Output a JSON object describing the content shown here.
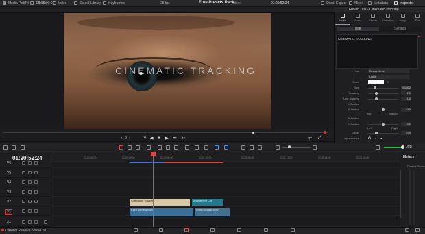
{
  "topbar": {
    "items": [
      "Media Pool",
      "Effects",
      "Index",
      "Sound Library",
      "Keyframes"
    ],
    "project_title": "Free Presets Pack",
    "project_state": "Edited",
    "right_items": [
      "Quick Export",
      "Mixer",
      "Metadata",
      "Inspector"
    ]
  },
  "viewer": {
    "zoom": "24%",
    "timecode_in": "00:00:00:01",
    "fps": "25 fps",
    "timecode": "01:20:52:24",
    "title_text": "CINEMATIC TRACKING",
    "frame_label": "6"
  },
  "inspector": {
    "title": "Fusion Title - Cinematic Tracking",
    "tabs": [
      "Video",
      "Audio",
      "Effects",
      "Transition",
      "Image",
      "File"
    ],
    "subtabs": [
      "Title",
      "Settings"
    ],
    "text_value": "CINEMATIC TRACKING",
    "font": "Bebas Neue",
    "style": "Light",
    "size": "0.0562",
    "tracking": "1.0",
    "line_spacing": "1.0",
    "v_anchor_val": "0.0",
    "h_anchor_val": "0.0",
    "offset": "0.0",
    "labels": {
      "font": "Font",
      "color": "Color",
      "size": "Size",
      "tracking": "Tracking",
      "line_spacing": "Line Spacing",
      "v_anchor": "V Anchor",
      "v_anchor2": "V Anchor",
      "h_anchor": "H Anchor",
      "h_anchor2": "H Anchor",
      "offset": "Offset",
      "appearance": "Appearance",
      "top": "Top",
      "bottom": "Bottom",
      "left": "Left",
      "right": "Right"
    }
  },
  "timeline": {
    "timecode": "01:20:52:24",
    "ruler_ticks": [
      "01:20:42:00",
      "01:20:48:00",
      "01:20:54:00",
      "01:21:00:00",
      "01:21:06:00",
      "01:21:12:00",
      "01:21:18:00",
      "01:21:24:00"
    ],
    "tracks": [
      {
        "name": "V6"
      },
      {
        "name": "V5"
      },
      {
        "name": "V4"
      },
      {
        "name": "V3"
      },
      {
        "name": "V2"
      },
      {
        "name": "V1"
      },
      {
        "name": "A1"
      }
    ],
    "clips": {
      "title_clip": "Cinematic Tracking",
      "adjustment_clip": "Adjustment Clip",
      "video_clip1": "Eye Opening.mp4",
      "video_clip2": "Photo Shoots.mov"
    },
    "volume": "0dB"
  },
  "meters": {
    "title": "Meters",
    "subtitle": "Control Room"
  },
  "status": {
    "app": "DaVinci Resolve Studio 20"
  }
}
